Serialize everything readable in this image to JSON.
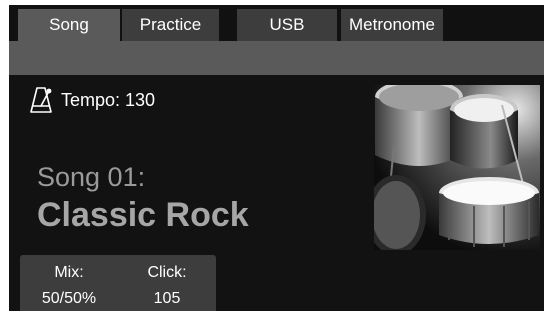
{
  "tabs": [
    {
      "label": "Song",
      "active": true
    },
    {
      "label": "Practice",
      "active": false
    },
    {
      "label": "USB",
      "active": false
    },
    {
      "label": "Metronome",
      "active": false
    }
  ],
  "tempo": {
    "icon": "metronome-icon",
    "text": "Tempo: 130"
  },
  "song": {
    "number": "Song 01:",
    "name": "Classic Rock"
  },
  "artwork": {
    "icon": "drum-kit-image"
  },
  "mix": {
    "label": "Mix:",
    "value": "50/50%"
  },
  "click": {
    "label": "Click:",
    "value": "105"
  },
  "colors": {
    "background": "#121212",
    "tab": "#3d3d3d",
    "tab_active": "#5a5a5a",
    "song_text": "#a6a6a6"
  }
}
